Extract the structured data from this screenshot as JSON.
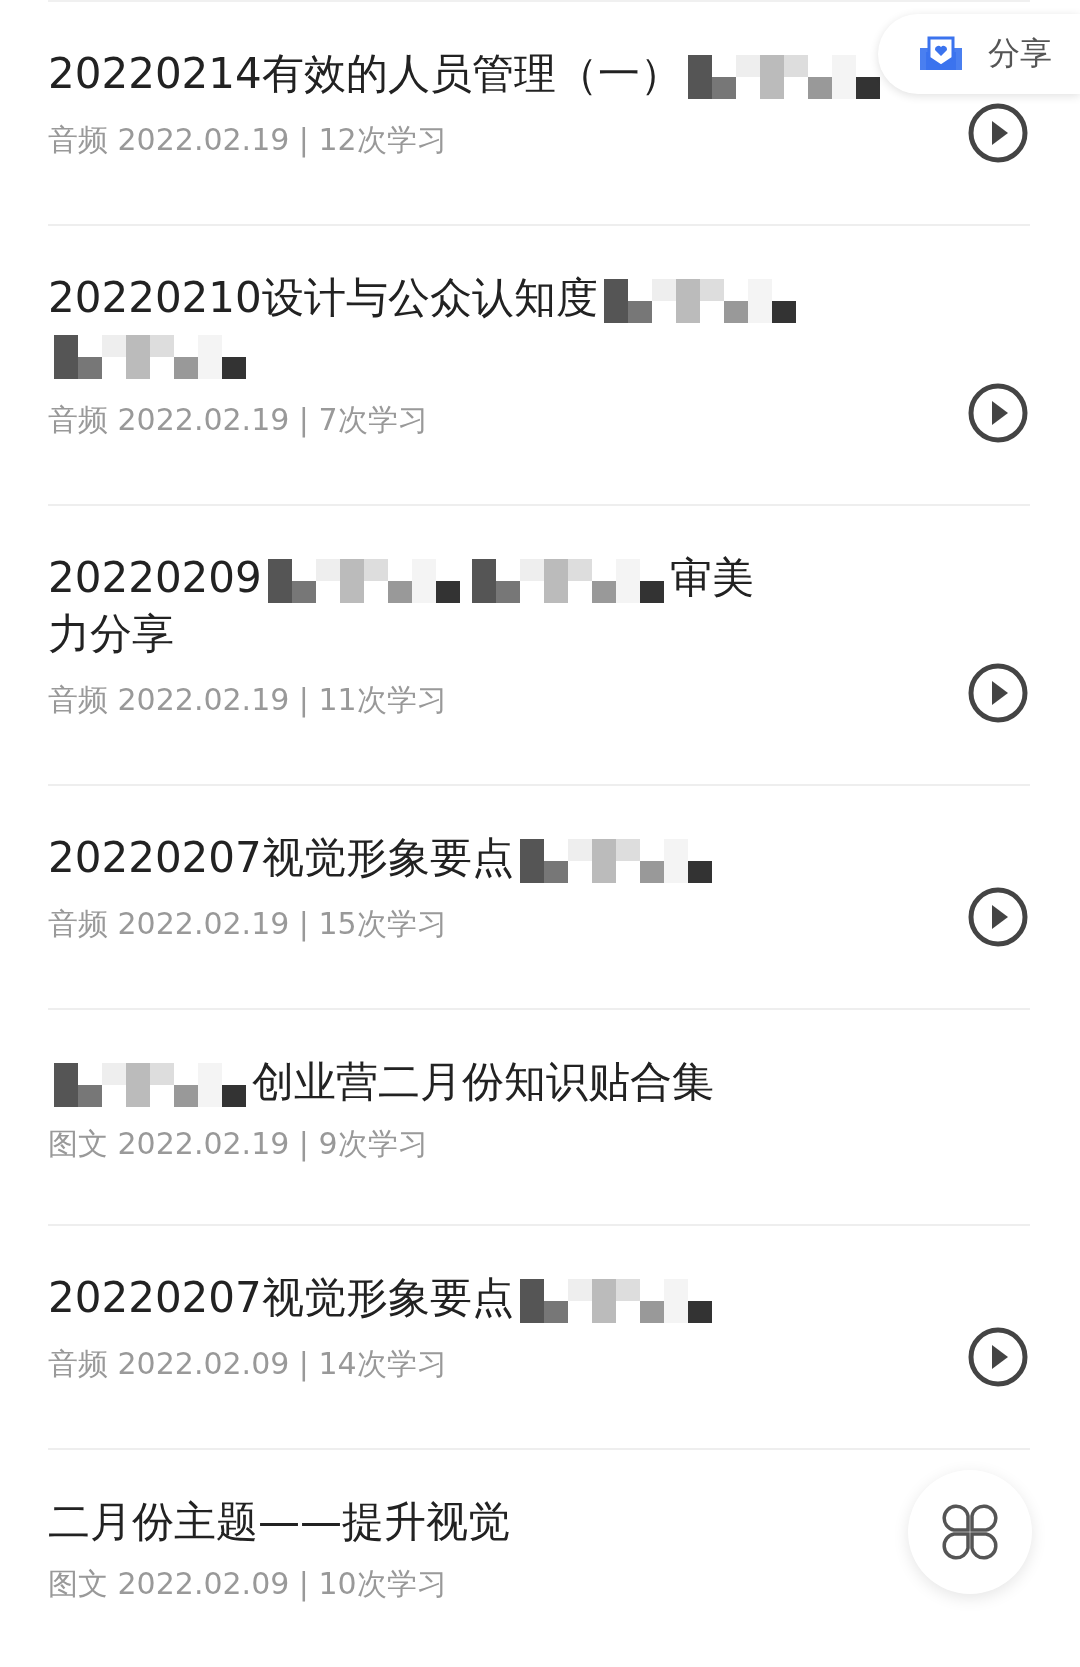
{
  "share_button": {
    "label": "分享"
  },
  "items": [
    {
      "title": [
        {
          "kind": "text",
          "text": "20220214有效的人员管理（一）"
        },
        {
          "kind": "redacted"
        }
      ],
      "meta": "音频 2022.02.19 | 12次学习",
      "playable": true
    },
    {
      "title": [
        {
          "kind": "text",
          "text": "20220210设计与公众认知度"
        },
        {
          "kind": "redacted"
        },
        {
          "kind": "redacted"
        }
      ],
      "meta": "音频 2022.02.19 | 7次学习",
      "playable": true
    },
    {
      "title": [
        {
          "kind": "text",
          "text": "20220209"
        },
        {
          "kind": "redacted"
        },
        {
          "kind": "redacted"
        },
        {
          "kind": "text",
          "text": "审美"
        },
        {
          "kind": "line_break"
        },
        {
          "kind": "text",
          "text": "力分享"
        }
      ],
      "meta": "音频 2022.02.19 | 11次学习",
      "playable": true
    },
    {
      "title": [
        {
          "kind": "text",
          "text": "20220207视觉形象要点"
        },
        {
          "kind": "redacted"
        }
      ],
      "meta": "音频 2022.02.19 | 15次学习",
      "playable": true
    },
    {
      "title": [
        {
          "kind": "redacted"
        },
        {
          "kind": "text",
          "text": "创业营二月份知识贴合集"
        }
      ],
      "meta": "图文 2022.02.19 | 9次学习",
      "playable": false
    },
    {
      "title": [
        {
          "kind": "text",
          "text": "20220207视觉形象要点"
        },
        {
          "kind": "redacted"
        }
      ],
      "meta": "音频 2022.02.09 | 14次学习",
      "playable": true
    },
    {
      "title": [
        {
          "kind": "text",
          "text": "二月份主题——提升视觉"
        }
      ],
      "meta": "图文 2022.02.09 | 10次学习",
      "playable": false
    }
  ]
}
